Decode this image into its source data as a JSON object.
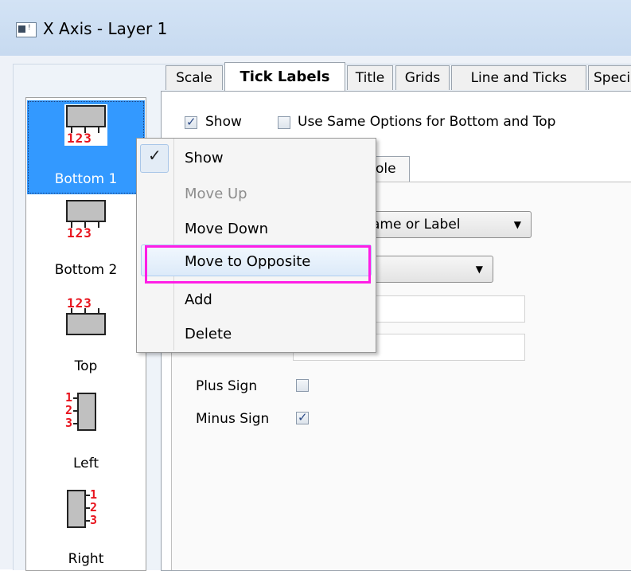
{
  "window": {
    "title": "X Axis - Layer 1"
  },
  "axis_list": {
    "items": [
      {
        "label": "Bottom 1",
        "icon": "axis-bottom-icon",
        "selected": true
      },
      {
        "label": "Bottom 2",
        "icon": "axis-bottom-icon"
      },
      {
        "label": "Top",
        "icon": "axis-top-icon"
      },
      {
        "label": "Left",
        "icon": "axis-left-icon"
      },
      {
        "label": "Right",
        "icon": "axis-right-icon"
      }
    ],
    "tick_digits": "123",
    "digit_1": "1",
    "digit_2": "2",
    "digit_3": "3"
  },
  "tabs": [
    "Scale",
    "Tick Labels",
    "Title",
    "Grids",
    "Line and Ticks",
    "Speci"
  ],
  "active_tab": "Tick Labels",
  "options": {
    "show_label": "Show",
    "show_checked": true,
    "same_options_label": "Use Same Options for Bottom and Top",
    "same_options_checked": false
  },
  "subtab": {
    "label_fragment": "ole"
  },
  "form": {
    "type_combo_value": "ame or Label",
    "second_combo_value": "",
    "plus_sign_label": "Plus Sign",
    "plus_sign_checked": false,
    "minus_sign_label": "Minus Sign",
    "minus_sign_checked": true
  },
  "context_menu": {
    "items": [
      {
        "label": "Show",
        "checked": true,
        "enabled": true
      },
      {
        "label": "Move Up",
        "enabled": false
      },
      {
        "label": "Move Down",
        "enabled": true
      },
      {
        "label": "Move to Opposite",
        "enabled": true,
        "highlighted": true
      },
      {
        "label": "Add",
        "enabled": true
      },
      {
        "label": "Delete",
        "enabled": true
      }
    ],
    "check_glyph": "✓"
  },
  "colors": {
    "highlight_box": "#ff1ee6",
    "selection": "#3399ff",
    "tick_digits": "#e8141e"
  }
}
